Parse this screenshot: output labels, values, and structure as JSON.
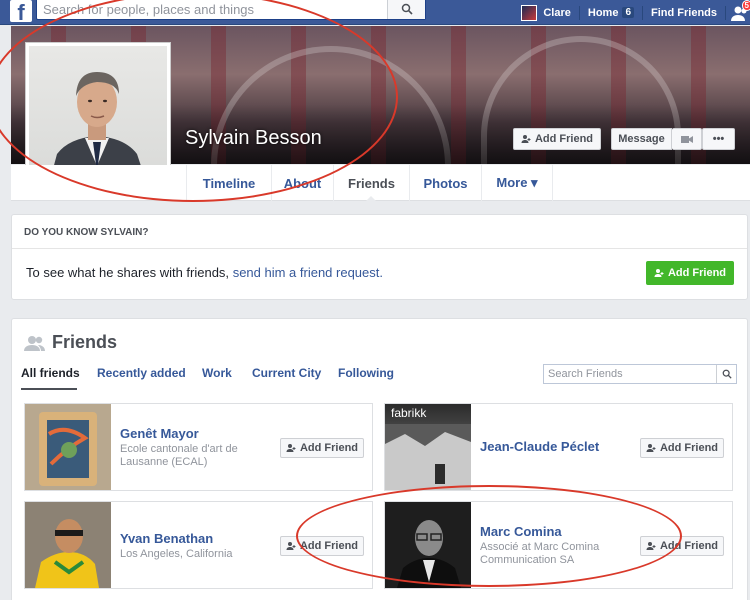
{
  "topbar": {
    "logo": "f",
    "search_placeholder": "Search for people, places and things",
    "user_name": "Clare",
    "home_label": "Home",
    "home_count": "6",
    "find_friends_label": "Find Friends",
    "friend_requests_badge": "5"
  },
  "profile": {
    "name": "Sylvain Besson",
    "add_friend_label": "Add Friend",
    "message_label": "Message",
    "more_label": "•••"
  },
  "tabs": [
    {
      "label": "Timeline"
    },
    {
      "label": "About"
    },
    {
      "label": "Friends"
    },
    {
      "label": "Photos"
    },
    {
      "label": "More ▾"
    }
  ],
  "know": {
    "heading": "DO YOU KNOW SYLVAIN?",
    "text": "To see what he shares with friends,",
    "link": "send him a friend request.",
    "button": "Add Friend"
  },
  "friends": {
    "title": "Friends",
    "tabs": [
      "All friends",
      "Recently added",
      "Work",
      "Current City",
      "Following"
    ],
    "search_placeholder": "Search Friends",
    "cards": [
      {
        "name": "Genêt Mayor",
        "line1": "Ecole cantonale d'art de",
        "line2": "Lausanne (ECAL)",
        "button": "Add Friend"
      },
      {
        "name": "Jean-Claude Péclet",
        "line1": "",
        "line2": "",
        "button": "Add Friend",
        "thumb_text": "fabrikk"
      },
      {
        "name": "Yvan Benathan",
        "line1": "Los Angeles, California",
        "line2": "",
        "button": "Add Friend"
      },
      {
        "name": "Marc Comina",
        "line1": "Associé at Marc Comina",
        "line2": "Communication SA",
        "button": "Add Friend"
      }
    ]
  },
  "annotation_color": "#d9392a",
  "colors": {
    "brand": "#3b5998",
    "link": "#365899",
    "green": "#42b72a"
  }
}
